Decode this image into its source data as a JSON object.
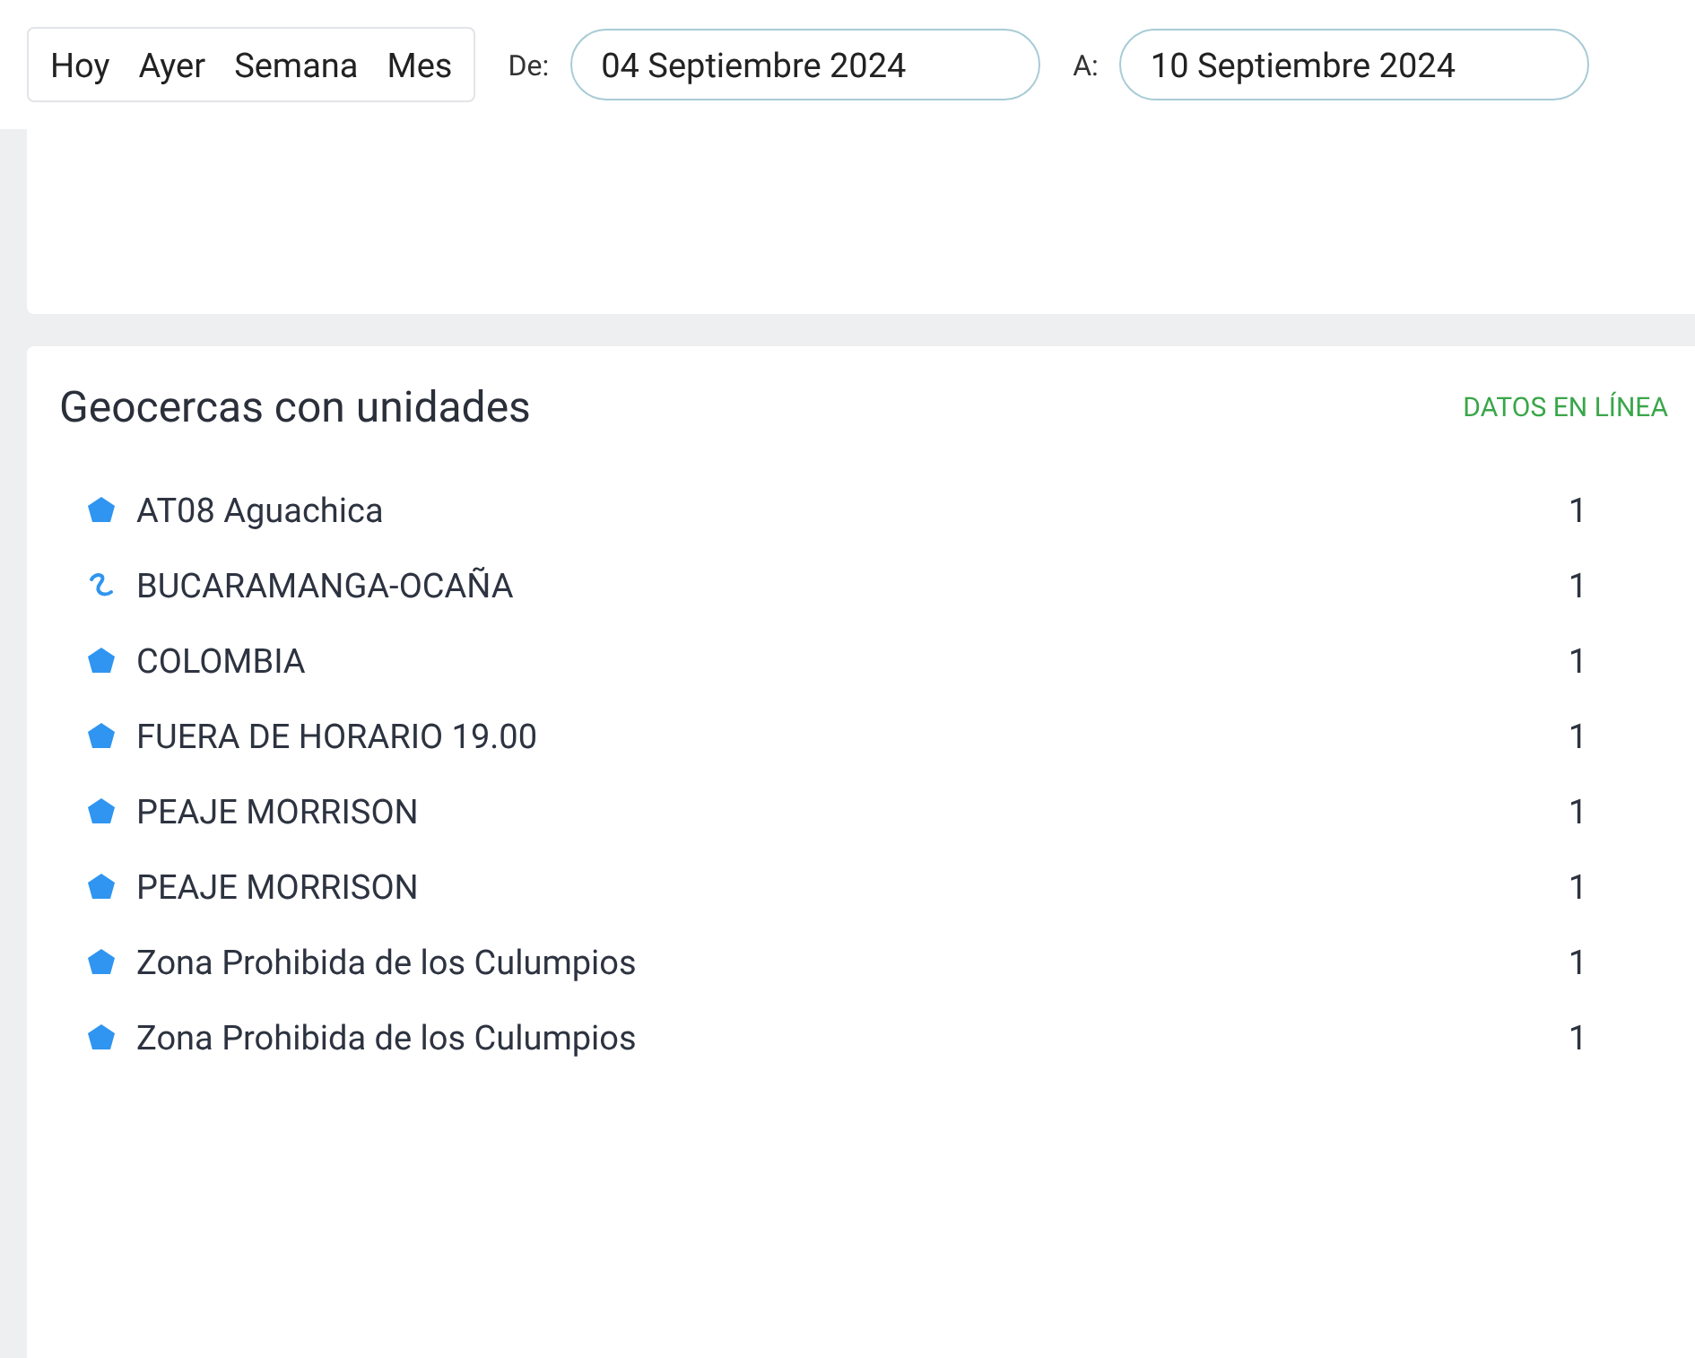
{
  "toolbar": {
    "presets": [
      {
        "label": "Hoy"
      },
      {
        "label": "Ayer"
      },
      {
        "label": "Semana"
      },
      {
        "label": "Mes"
      }
    ],
    "from": {
      "label": "De:",
      "value": "04 Septiembre 2024"
    },
    "to": {
      "label": "A:",
      "value": "10 Septiembre 2024"
    }
  },
  "geofences": {
    "title": "Geocercas con unidades",
    "status": "DATOS EN LÍNEA",
    "items": [
      {
        "kind": "polygon",
        "name": "AT08 Aguachica",
        "count": "1"
      },
      {
        "kind": "route",
        "name": "BUCARAMANGA-OCAÑA",
        "count": "1"
      },
      {
        "kind": "polygon",
        "name": "COLOMBIA",
        "count": "1"
      },
      {
        "kind": "polygon",
        "name": "FUERA DE HORARIO 19.00",
        "count": "1"
      },
      {
        "kind": "polygon",
        "name": "PEAJE MORRISON",
        "count": "1"
      },
      {
        "kind": "polygon",
        "name": "PEAJE MORRISON",
        "count": "1"
      },
      {
        "kind": "polygon",
        "name": "Zona Prohibida de los Culumpios",
        "count": "1"
      },
      {
        "kind": "polygon",
        "name": "Zona Prohibida de los Culumpios",
        "count": "1"
      }
    ]
  }
}
